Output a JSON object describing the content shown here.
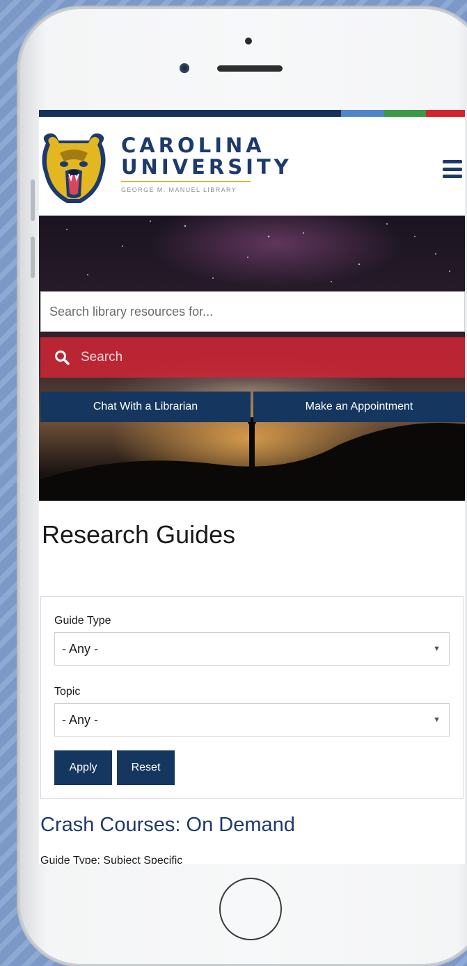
{
  "brand": {
    "line1": "CAROLINA",
    "line2": "UNIVERSITY",
    "subtitle": "GEORGE M. MANUEL LIBRARY",
    "colors": {
      "navy": "#1d3a6e",
      "gold": "#e2b721",
      "red": "#cd2634"
    }
  },
  "topbar": {
    "colors": [
      "#16325c",
      "#4f86c9",
      "#3a9a47",
      "#d0262f"
    ]
  },
  "header": {
    "menu_icon": "hamburger-menu-icon"
  },
  "search": {
    "placeholder": "Search library resources for...",
    "button_label": "Search",
    "icon": "search-icon"
  },
  "cta": {
    "chat_label": "Chat With a Librarian",
    "appointment_label": "Make an Appointment"
  },
  "page": {
    "title": "Research Guides"
  },
  "filters": {
    "guide_type_label": "Guide Type",
    "guide_type_value": "- Any -",
    "topic_label": "Topic",
    "topic_value": "- Any -",
    "apply_label": "Apply",
    "reset_label": "Reset"
  },
  "results": [
    {
      "title": "Crash Courses: On Demand",
      "meta": "Guide Type: Subject Specific"
    }
  ]
}
